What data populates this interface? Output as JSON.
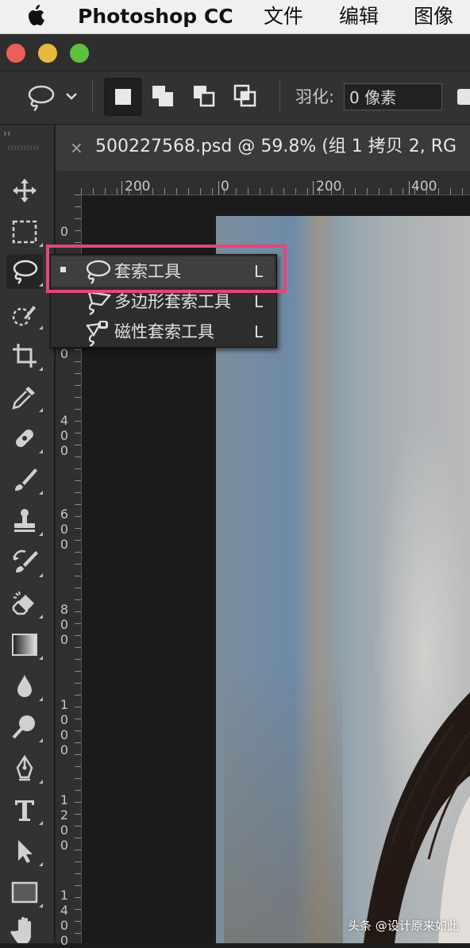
{
  "menubar": {
    "app_name": "Photoshop CC",
    "items": [
      "文件",
      "编辑",
      "图像"
    ]
  },
  "window": {
    "traffic_lights": {
      "close": "#ec5f57",
      "minimize": "#e9b93a",
      "zoom": "#5fc040"
    }
  },
  "options_bar": {
    "tool_icon": "lasso-icon",
    "feather_label": "羽化:",
    "feather_value": "0 像素"
  },
  "tools": [
    "move-icon",
    "marquee-icon",
    "lasso-icon",
    "quick-selection-icon",
    "crop-icon",
    "eyedropper-icon",
    "healing-brush-icon",
    "brush-icon",
    "clone-stamp-icon",
    "history-brush-icon",
    "eraser-icon",
    "gradient-icon",
    "blur-icon",
    "dodge-icon",
    "pen-icon",
    "type-icon",
    "path-selection-icon",
    "rectangle-icon",
    "hand-icon"
  ],
  "document_tab": {
    "close_glyph": "×",
    "title": "500227568.psd @ 59.8% (组 1 拷贝 2, RG"
  },
  "rulers": {
    "horizontal": [
      "200",
      "0",
      "200",
      "400"
    ],
    "vertical": [
      "0",
      "2",
      "0",
      "4\n0\n0",
      "6\n0\n0",
      "8\n0\n0",
      "1\n0\n0\n0",
      "1\n2\n0\n0",
      "1\n4\n0\n0"
    ]
  },
  "flyout": {
    "items": [
      {
        "label": "套索工具",
        "shortcut": "L",
        "icon": "lasso-icon",
        "selected": true
      },
      {
        "label": "多边形套索工具",
        "shortcut": "L",
        "icon": "polygonal-lasso-icon",
        "selected": false
      },
      {
        "label": "磁性套索工具",
        "shortcut": "L",
        "icon": "magnetic-lasso-icon",
        "selected": false
      }
    ],
    "highlight_color": "#e6457a"
  },
  "watermark": "头条 @设计原来如此"
}
